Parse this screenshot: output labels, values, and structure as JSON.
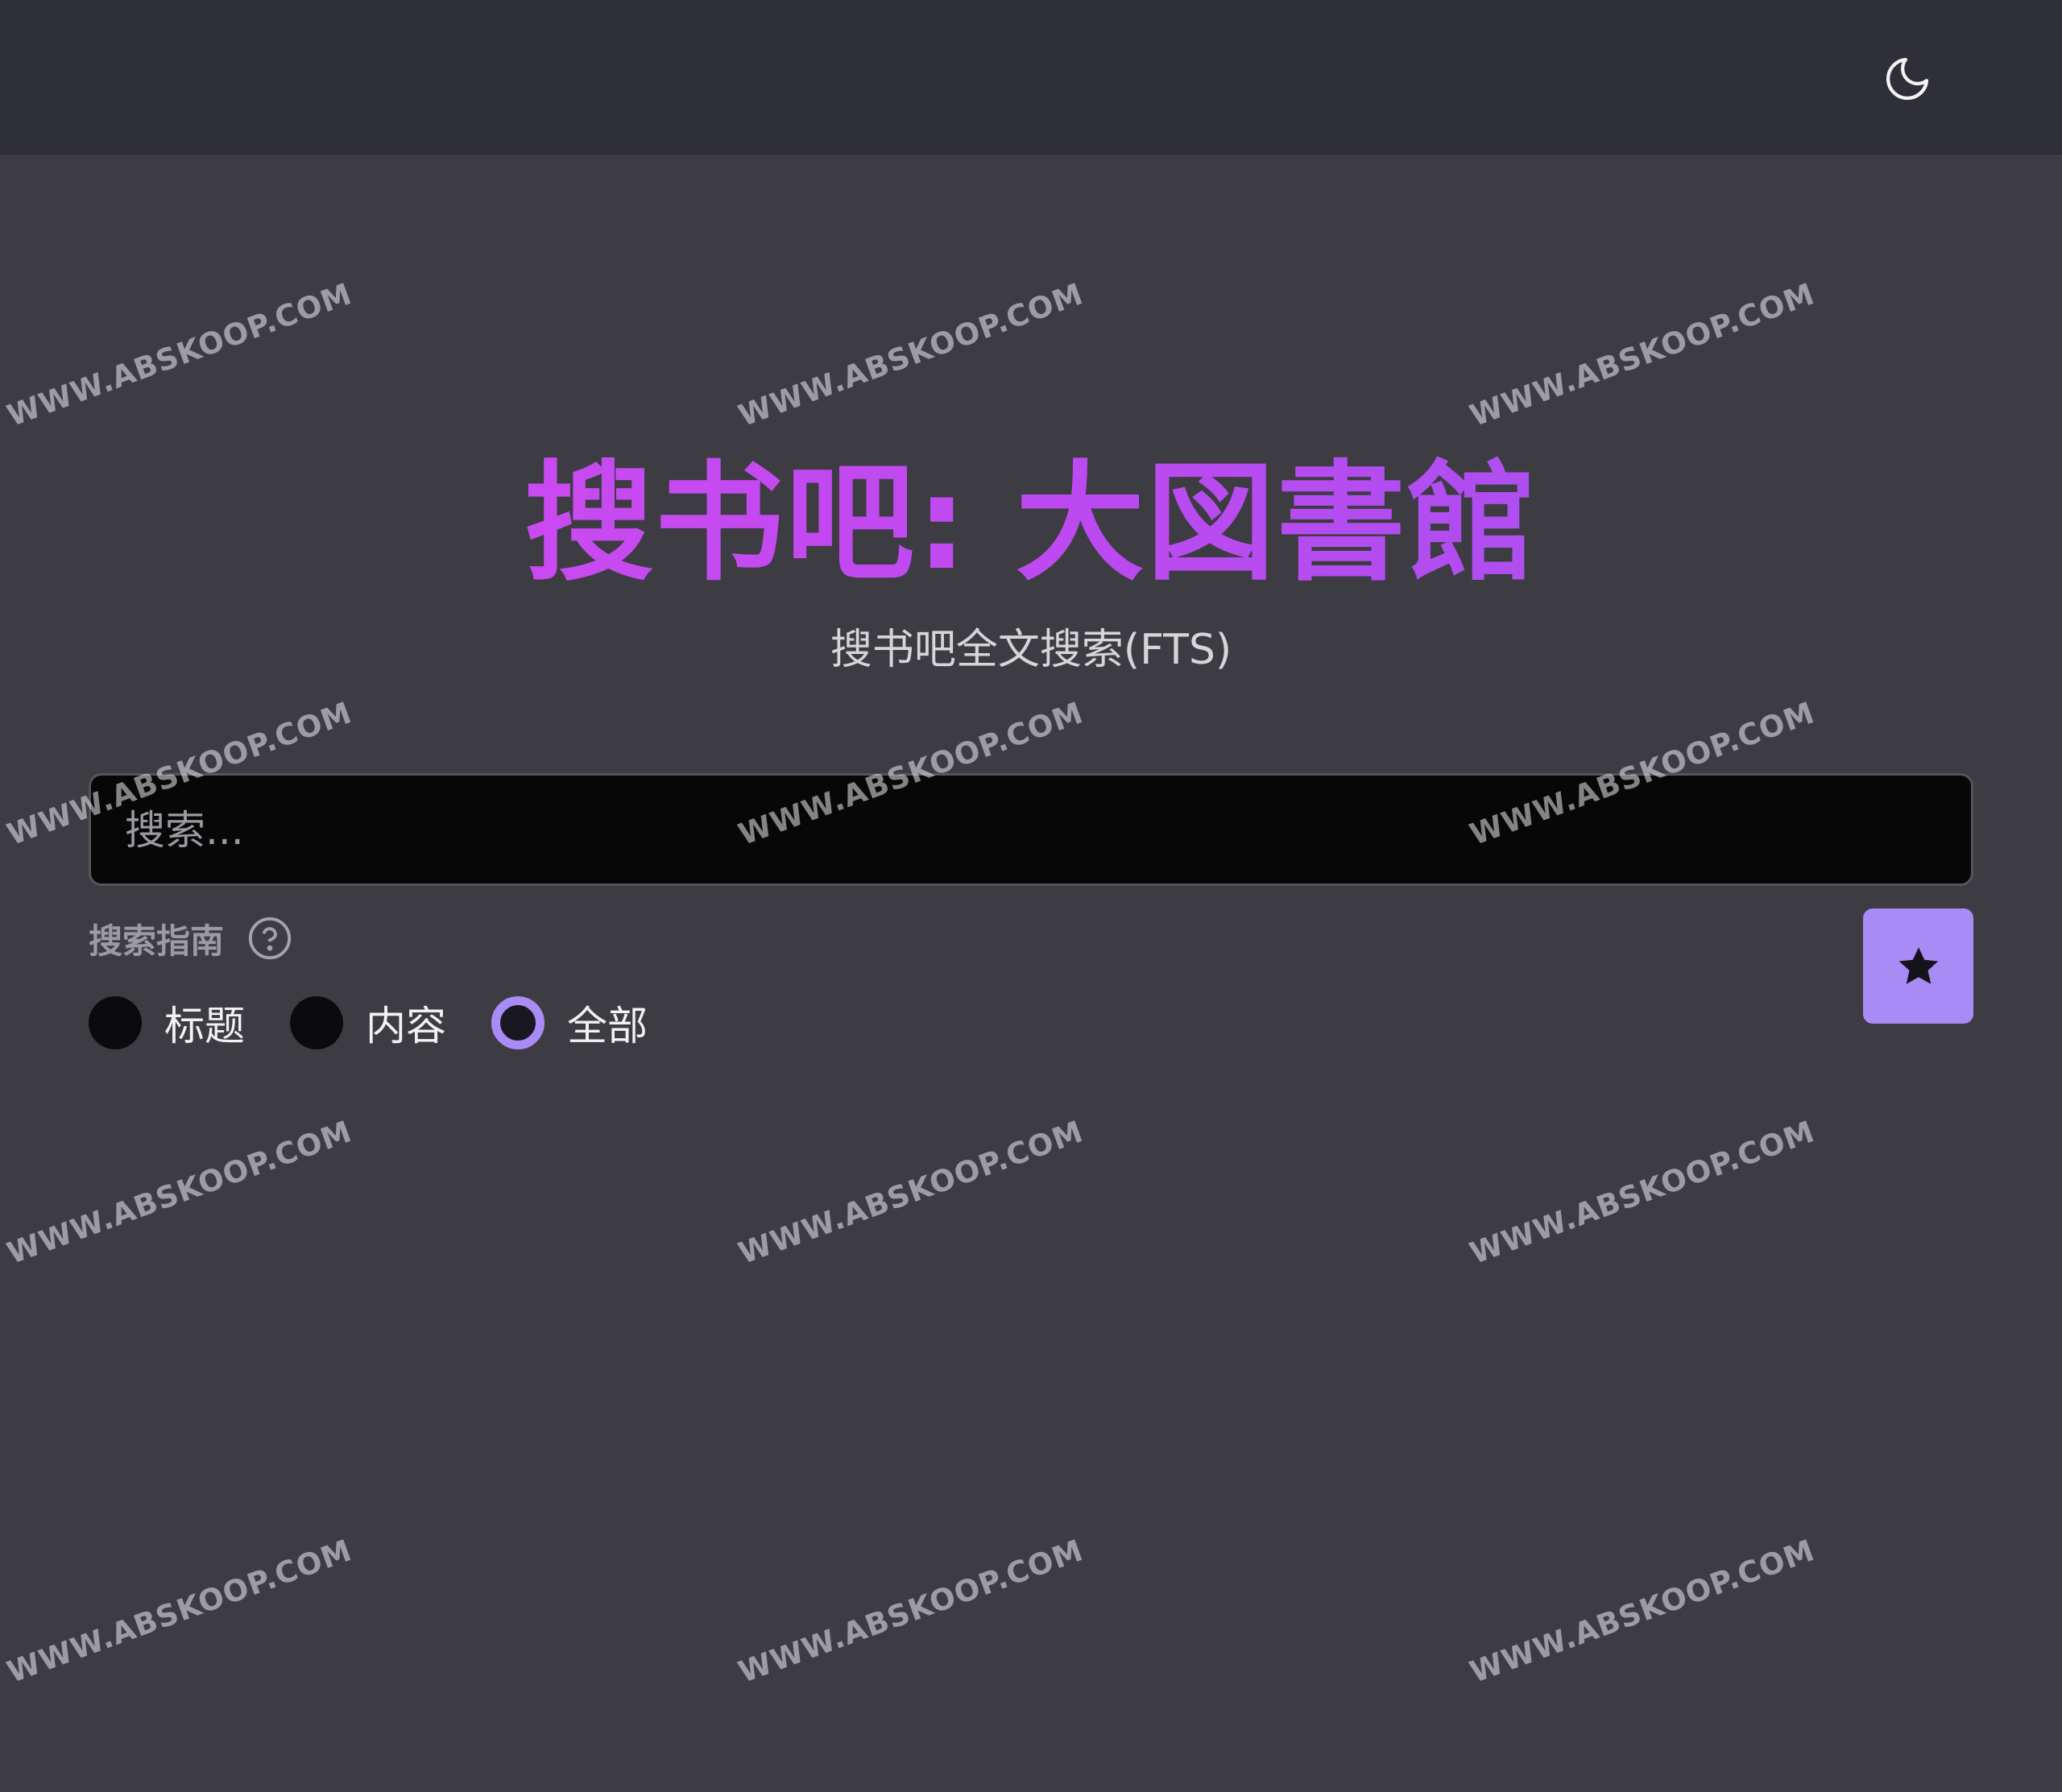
{
  "header": {
    "theme_toggle_icon": "moon-icon"
  },
  "hero": {
    "title": "搜书吧: 大図書館",
    "subtitle": "搜书吧全文搜索(FTS)"
  },
  "search": {
    "placeholder": "搜索...",
    "value": ""
  },
  "guide": {
    "label": "搜索指南",
    "icon": "help-circle-icon"
  },
  "modes": {
    "options": [
      {
        "label": "标题",
        "checked": false
      },
      {
        "label": "内容",
        "checked": false
      },
      {
        "label": "全部",
        "checked": true
      }
    ]
  },
  "favorites_button": {
    "icon": "star-icon"
  },
  "watermark": {
    "text": "WWW.ABSKOOP.COM"
  },
  "colors": {
    "page_bg": "#3d3c43",
    "topbar_bg": "#2e2f37",
    "accent": "#a98bf5",
    "title_gradient_start": "#d44bf0",
    "title_gradient_end": "#a052f0"
  }
}
